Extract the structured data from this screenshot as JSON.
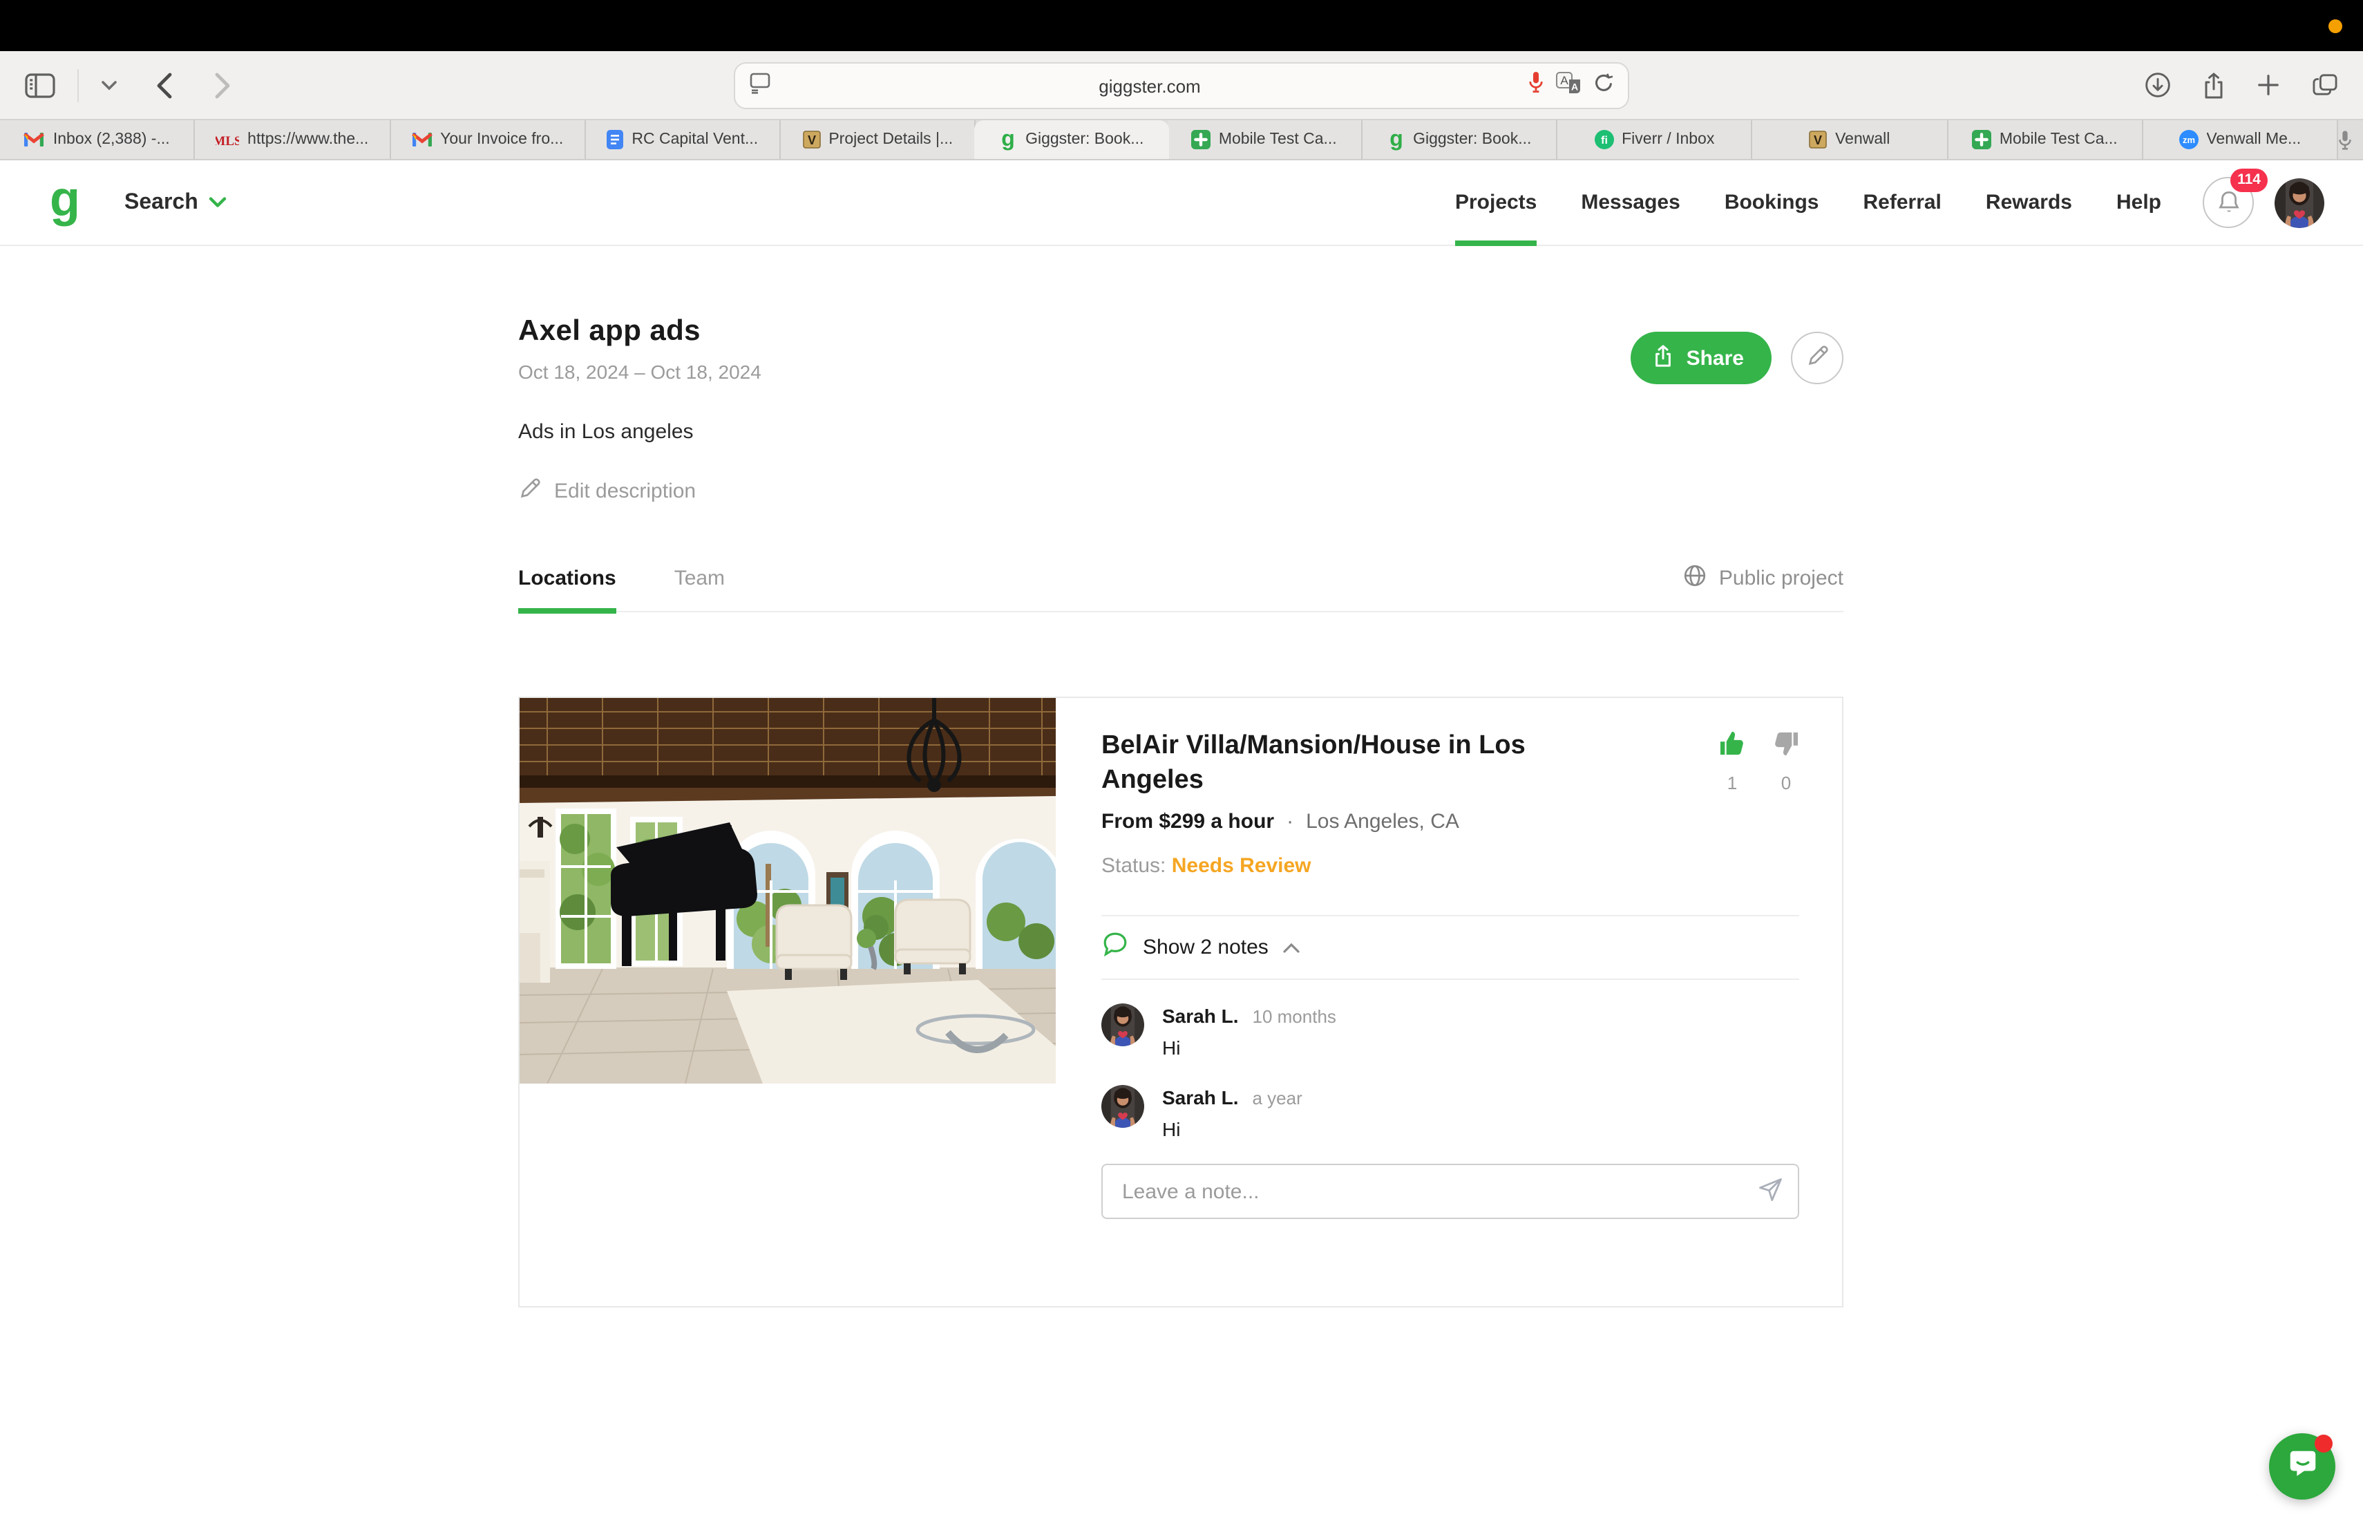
{
  "chrome": {
    "url": "giggster.com",
    "tabs": [
      {
        "label": "Inbox (2,388) -...",
        "icon": "gmail-favicon"
      },
      {
        "label": "https://www.the...",
        "icon": "mls-favicon"
      },
      {
        "label": "Your Invoice fro...",
        "icon": "gmail-favicon"
      },
      {
        "label": "RC Capital Vent...",
        "icon": "docs-favicon"
      },
      {
        "label": "Project Details |...",
        "icon": "venwall-favicon"
      },
      {
        "label": "Giggster: Book...",
        "icon": "giggster-favicon",
        "active": true
      },
      {
        "label": "Mobile Test Ca...",
        "icon": "green-plus-favicon"
      },
      {
        "label": "Giggster: Book...",
        "icon": "giggster-favicon"
      },
      {
        "label": "Fiverr / Inbox",
        "icon": "fiverr-favicon"
      },
      {
        "label": "Venwall",
        "icon": "venwall-favicon"
      },
      {
        "label": "Mobile Test Ca...",
        "icon": "green-plus-favicon"
      },
      {
        "label": "Venwall Me...",
        "icon": "zoom-favicon"
      }
    ]
  },
  "header": {
    "search_label": "Search",
    "nav": [
      {
        "label": "Projects",
        "active": true
      },
      {
        "label": "Messages"
      },
      {
        "label": "Bookings"
      },
      {
        "label": "Referral"
      },
      {
        "label": "Rewards"
      },
      {
        "label": "Help"
      }
    ],
    "notification_count": "114"
  },
  "project": {
    "title": "Axel app ads",
    "date_range": "Oct 18, 2024 – Oct 18, 2024",
    "description": "Ads in Los angeles",
    "edit_label": "Edit description",
    "share_label": "Share",
    "tab_locations": "Locations",
    "tab_team": "Team",
    "visibility_label": "Public project"
  },
  "listing": {
    "title": "BelAir Villa/Mansion/House in Los Angeles",
    "price": "From $299 a hour",
    "dot": "·",
    "location": "Los Angeles, CA",
    "status_label": "Status:",
    "status_value": "Needs Review",
    "upvotes": "1",
    "downvotes": "0",
    "notes_toggle": "Show 2 notes"
  },
  "notes": [
    {
      "author": "Sarah L.",
      "time": "10 months",
      "text": "Hi"
    },
    {
      "author": "Sarah L.",
      "time": "a year",
      "text": "Hi"
    }
  ],
  "note_input": {
    "placeholder": "Leave a note..."
  },
  "colors": {
    "brand_green": "#35B44A",
    "status_orange": "#F5A623",
    "badge_red": "#F5314D",
    "chat_green": "#2CA83C",
    "recording_dot": "#F5A000"
  }
}
